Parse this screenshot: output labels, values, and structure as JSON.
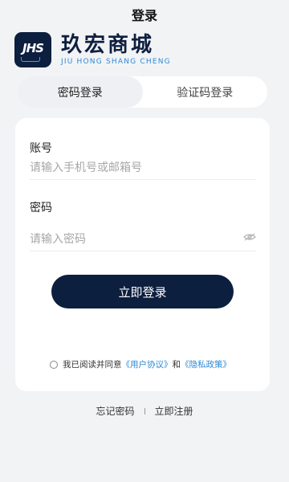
{
  "header": {
    "title": "登录"
  },
  "brand": {
    "logo_text": "JHS",
    "name_cn": "玖宏商城",
    "name_en": "JIU HONG SHANG CHENG"
  },
  "tabs": [
    {
      "label": "密码登录",
      "active": true
    },
    {
      "label": "验证码登录",
      "active": false
    }
  ],
  "form": {
    "account_label": "账号",
    "account_placeholder": "请输入手机号或邮箱号",
    "password_label": "密码",
    "password_placeholder": "请输入密码",
    "login_button": "立即登录"
  },
  "agreement": {
    "prefix": "我已阅读并同意",
    "user_agreement": "《用户协议》",
    "and": "和",
    "privacy_policy": "《隐私政策》"
  },
  "footer": {
    "forgot_password": "忘记密码",
    "register": "立即注册"
  },
  "colors": {
    "primary": "#0d1f3f",
    "link": "#2c8ad6",
    "background": "#f2f3f5"
  }
}
